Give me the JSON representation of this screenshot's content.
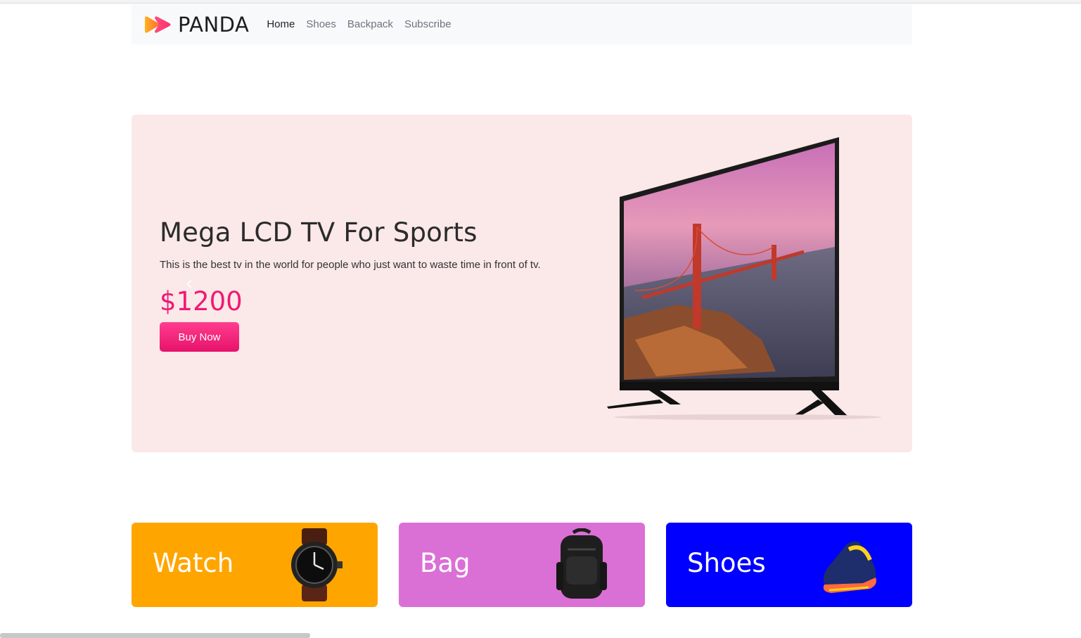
{
  "navbar": {
    "brand": "PANDA",
    "links": [
      {
        "label": "Home",
        "active": true
      },
      {
        "label": "Shoes",
        "active": false
      },
      {
        "label": "Backpack",
        "active": false
      },
      {
        "label": "Subscribe",
        "active": false
      }
    ]
  },
  "hero": {
    "title": "Mega LCD TV For Sports",
    "description": "This is the best tv in the world for people who just want to waste time in front of tv.",
    "price": "$1200",
    "button_label": "Buy Now",
    "prev_icon": "chevron-left-icon",
    "next_icon": "chevron-right-icon",
    "background_color": "#fbe8e8",
    "price_color": "#ef1a74"
  },
  "categories": [
    {
      "label": "Watch",
      "color": "#ffa500",
      "icon": "watch-icon"
    },
    {
      "label": "Bag",
      "color": "#da70d6",
      "icon": "backpack-icon"
    },
    {
      "label": "Shoes",
      "color": "#0000ff",
      "icon": "sneaker-icon"
    }
  ]
}
